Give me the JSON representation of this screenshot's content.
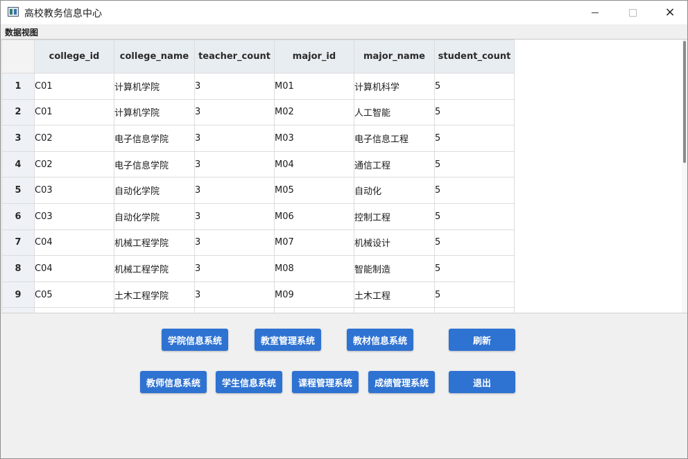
{
  "window": {
    "title": "高校教务信息中心",
    "icon": "app-window-icon",
    "controls": {
      "minimize": "minimize-icon",
      "maximize": "maximize-icon",
      "close": "×"
    }
  },
  "group_label": "数据视图",
  "table": {
    "columns": [
      "college_id",
      "college_name",
      "teacher_count",
      "major_id",
      "major_name",
      "student_count"
    ],
    "rows": [
      {
        "num": "1",
        "cells": [
          "C01",
          "计算机学院",
          "3",
          "M01",
          "计算机科学",
          "5"
        ]
      },
      {
        "num": "2",
        "cells": [
          "C01",
          "计算机学院",
          "3",
          "M02",
          "人工智能",
          "5"
        ]
      },
      {
        "num": "3",
        "cells": [
          "C02",
          "电子信息学院",
          "3",
          "M03",
          "电子信息工程",
          "5"
        ]
      },
      {
        "num": "4",
        "cells": [
          "C02",
          "电子信息学院",
          "3",
          "M04",
          "通信工程",
          "5"
        ]
      },
      {
        "num": "5",
        "cells": [
          "C03",
          "自动化学院",
          "3",
          "M05",
          "自动化",
          "5"
        ]
      },
      {
        "num": "6",
        "cells": [
          "C03",
          "自动化学院",
          "3",
          "M06",
          "控制工程",
          "5"
        ]
      },
      {
        "num": "7",
        "cells": [
          "C04",
          "机械工程学院",
          "3",
          "M07",
          "机械设计",
          "5"
        ]
      },
      {
        "num": "8",
        "cells": [
          "C04",
          "机械工程学院",
          "3",
          "M08",
          "智能制造",
          "5"
        ]
      },
      {
        "num": "9",
        "cells": [
          "C05",
          "土木工程学院",
          "3",
          "M09",
          "土木工程",
          "5"
        ]
      },
      {
        "num": "",
        "cells": [
          "",
          "",
          "",
          "",
          "",
          ""
        ]
      }
    ]
  },
  "buttons": {
    "college_info": "学院信息系统",
    "classroom_mgmt": "教室管理系统",
    "textbook_info": "教材信息系统",
    "refresh": "刷新",
    "teacher_info": "教师信息系统",
    "student_info": "学生信息系统",
    "course_mgmt": "课程管理系统",
    "grade_mgmt": "成绩管理系统",
    "exit": "退出"
  },
  "colors": {
    "button_bg": "#2e72d2",
    "header_bg": "#e8edf2",
    "window_bg": "#f0f0f0"
  }
}
